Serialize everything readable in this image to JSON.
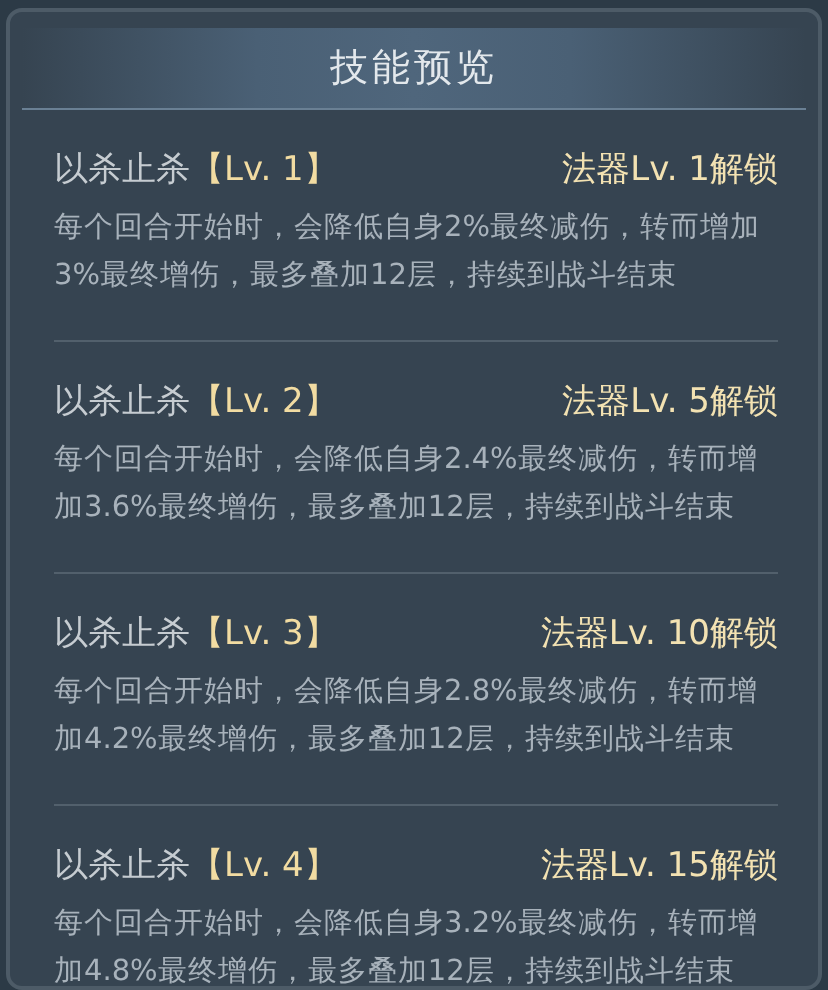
{
  "title": "技能预览",
  "skills": [
    {
      "name": "以杀止杀",
      "level": "【Lv. 1】",
      "unlock": "法器Lv. 1解锁",
      "description": "每个回合开始时，会降低自身2%最终减伤，转而增加3%最终增伤，最多叠加12层，持续到战斗结束"
    },
    {
      "name": "以杀止杀",
      "level": "【Lv. 2】",
      "unlock": "法器Lv. 5解锁",
      "description": "每个回合开始时，会降低自身2.4%最终减伤，转而增加3.6%最终增伤，最多叠加12层，持续到战斗结束"
    },
    {
      "name": "以杀止杀",
      "level": "【Lv. 3】",
      "unlock": "法器Lv. 10解锁",
      "description": "每个回合开始时，会降低自身2.8%最终减伤，转而增加4.2%最终增伤，最多叠加12层，持续到战斗结束"
    },
    {
      "name": "以杀止杀",
      "level": "【Lv. 4】",
      "unlock": "法器Lv. 15解锁",
      "description": "每个回合开始时，会降低自身3.2%最终减伤，转而增加4.8%最终增伤，最多叠加12层，持续到战斗结束"
    }
  ]
}
